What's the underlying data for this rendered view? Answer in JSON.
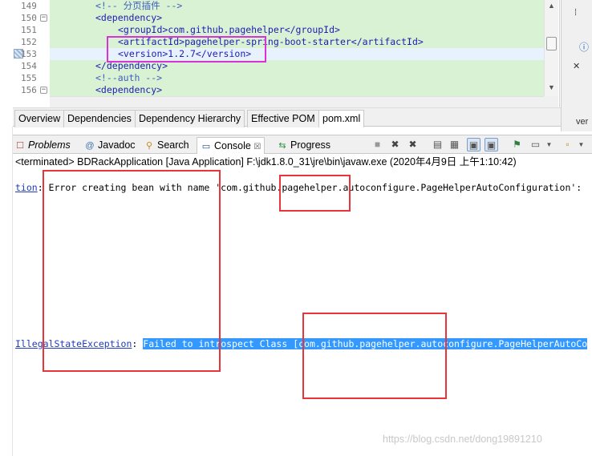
{
  "editor": {
    "lines": [
      {
        "num": "149",
        "text": "<!-- 分页插件 -->"
      },
      {
        "num": "150",
        "text": "<dependency>"
      },
      {
        "num": "151",
        "text": "<groupId>com.github.pagehelper</groupId>"
      },
      {
        "num": "152",
        "text": "<artifactId>pagehelper-spring-boot-starter</artifactId>"
      },
      {
        "num": "153",
        "text": "<version>1.2.7</version>"
      },
      {
        "num": "154",
        "text": "</dependency>"
      },
      {
        "num": "155",
        "text": "<!--auth -->"
      },
      {
        "num": "156",
        "text": "<dependency>"
      }
    ]
  },
  "editor_tabs": [
    "Overview",
    "Dependencies",
    "Dependency Hierarchy",
    "Effective POM",
    "pom.xml"
  ],
  "right_strip": {
    "bottom_label": "ver"
  },
  "view_tabs": [
    {
      "label": "Problems",
      "icon": "problems-icon"
    },
    {
      "label": "Javadoc",
      "icon": "javadoc-icon"
    },
    {
      "label": "Search",
      "icon": "search-icon"
    },
    {
      "label": "Console",
      "icon": "console-icon",
      "close": "☒"
    },
    {
      "label": "Progress",
      "icon": "progress-icon"
    }
  ],
  "console": {
    "status": "<terminated> BDRackApplication [Java Application] F:\\jdk1.8.0_31\\jre\\bin\\javaw.exe (2020年4月9日 上午1:10:42)",
    "line1_link": "tion",
    "line1_text": ": Error creating bean with name 'com.github.pagehelper.autoconfigure.PageHelperAutoConfiguration':",
    "line2_link": "IllegalStateException",
    "line2_colon": ": ",
    "line2_selected": "Failed to introspect Class [com.github.pagehelper.autoconfigure.PageHelperAutoCo"
  },
  "watermark": "https://blog.csdn.net/dong19891210"
}
